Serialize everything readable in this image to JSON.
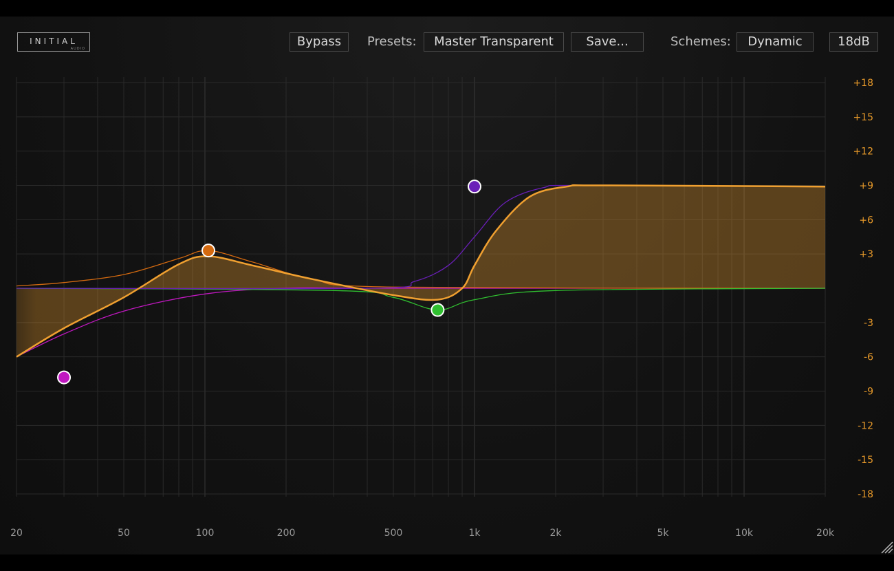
{
  "header": {
    "logo_text": "INITIAL",
    "logo_sub": "AUDIO",
    "bypass_label": "Bypass",
    "presets_label": "Presets:",
    "preset_value": "Master Transparent",
    "save_label": "Save...",
    "schemes_label": "Schemes:",
    "scheme_value": "Dynamic",
    "range_value": "18dB"
  },
  "colors": {
    "accent_orange": "#f0a030",
    "db_label": "#e89a2a",
    "band_purple": "#6a1fb8",
    "band_magenta": "#c018c0",
    "band_orange": "#d46a10",
    "band_green": "#30c030"
  },
  "chart_data": {
    "type": "line",
    "x_scale": "log",
    "xlim": [
      20,
      20000
    ],
    "ylim": [
      -18,
      18
    ],
    "x_ticks": [
      {
        "value": 20,
        "label": "20"
      },
      {
        "value": 50,
        "label": "50"
      },
      {
        "value": 100,
        "label": "100"
      },
      {
        "value": 200,
        "label": "200"
      },
      {
        "value": 500,
        "label": "500"
      },
      {
        "value": 1000,
        "label": "1k"
      },
      {
        "value": 2000,
        "label": "2k"
      },
      {
        "value": 5000,
        "label": "5k"
      },
      {
        "value": 10000,
        "label": "10k"
      },
      {
        "value": 20000,
        "label": "20k"
      }
    ],
    "y_ticks": [
      {
        "value": 18,
        "label": "+18"
      },
      {
        "value": 15,
        "label": "+15"
      },
      {
        "value": 12,
        "label": "+12"
      },
      {
        "value": 9,
        "label": "+9"
      },
      {
        "value": 6,
        "label": "+6"
      },
      {
        "value": 3,
        "label": "+3"
      },
      {
        "value": -3,
        "label": "-3"
      },
      {
        "value": -6,
        "label": "-6"
      },
      {
        "value": -9,
        "label": "-9"
      },
      {
        "value": -12,
        "label": "-12"
      },
      {
        "value": -15,
        "label": "-15"
      },
      {
        "value": -18,
        "label": "-18"
      }
    ],
    "grid": true,
    "bands": [
      {
        "id": "low-cut",
        "type": "highpass",
        "freq": 30,
        "gain": -7.8,
        "color": "#c018c0"
      },
      {
        "id": "bell-low",
        "type": "bell",
        "freq": 103,
        "gain": 3.3,
        "color": "#d46a10"
      },
      {
        "id": "bell-mid",
        "type": "bell",
        "freq": 730,
        "gain": -1.9,
        "color": "#30c030"
      },
      {
        "id": "high-shelf",
        "type": "highshelf",
        "freq": 1000,
        "gain": 8.9,
        "color": "#6a1fb8"
      }
    ],
    "curves": [
      {
        "id": "magenta",
        "color": "#c018c0",
        "x": [
          20,
          30,
          50,
          100,
          200,
          500,
          20000
        ],
        "y": [
          -6.0,
          -4.0,
          -2.0,
          -0.5,
          0,
          0,
          0
        ]
      },
      {
        "id": "orange-band",
        "color": "#d46a10",
        "x": [
          20,
          30,
          50,
          80,
          103,
          150,
          250,
          500,
          20000
        ],
        "y": [
          0.2,
          0.5,
          1.2,
          2.6,
          3.3,
          2.3,
          0.8,
          0.1,
          0
        ]
      },
      {
        "id": "green",
        "color": "#30c030",
        "x": [
          20,
          300,
          500,
          730,
          1000,
          2000,
          20000
        ],
        "y": [
          0,
          -0.2,
          -0.8,
          -1.9,
          -1.0,
          -0.2,
          0
        ]
      },
      {
        "id": "purple",
        "color": "#6a1fb8",
        "x": [
          20,
          400,
          600,
          800,
          1000,
          1300,
          1800,
          2500,
          20000
        ],
        "y": [
          0,
          0,
          0.6,
          2.0,
          4.5,
          7.5,
          8.8,
          9.0,
          8.9
        ]
      },
      {
        "id": "sum",
        "color": "#f0a030",
        "x": [
          20,
          30,
          50,
          80,
          103,
          150,
          250,
          500,
          730,
          900,
          1000,
          1200,
          1600,
          2200,
          3000,
          20000
        ],
        "y": [
          -6.0,
          -3.5,
          -0.8,
          2.1,
          2.8,
          2.0,
          0.8,
          -0.6,
          -1.0,
          0,
          2.0,
          5.0,
          8.0,
          8.9,
          9.0,
          8.9
        ]
      }
    ]
  }
}
